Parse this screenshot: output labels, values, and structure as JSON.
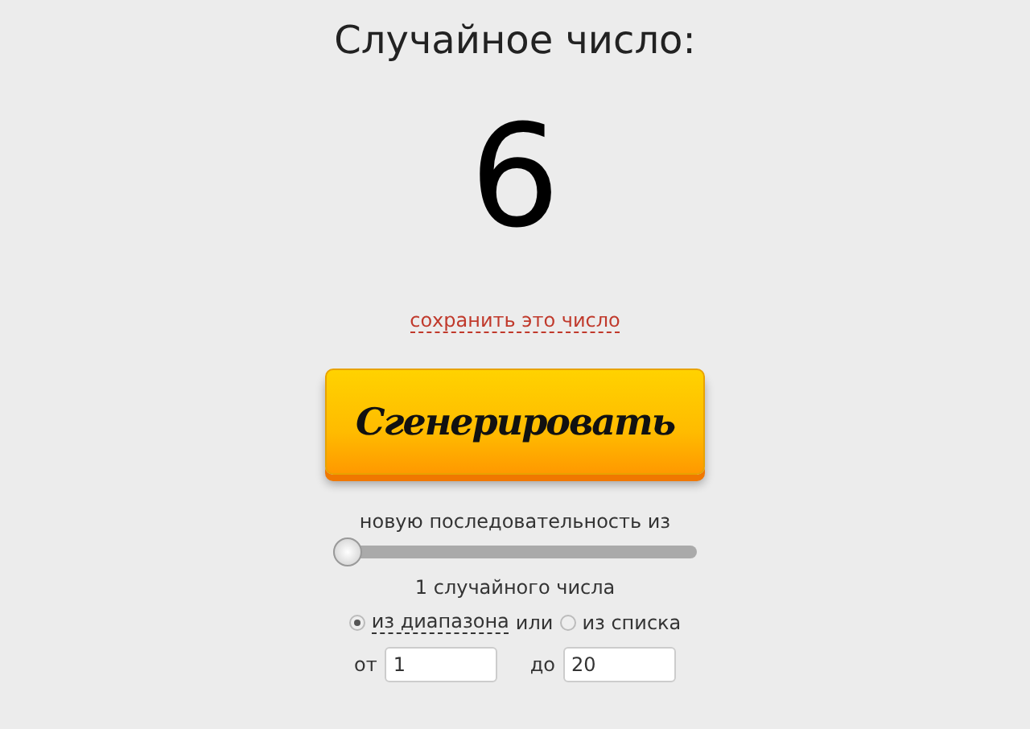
{
  "title": "Случайное число:",
  "number": "6",
  "save_link": "сохранить это число",
  "generate_button": "Сгенерировать",
  "sequence_label": "новую последовательность из",
  "count_slider": {
    "level": 0
  },
  "count_text": "1 случайного числа",
  "source_options": [
    {
      "label": "из диапазона",
      "selected": true
    },
    {
      "label": "из списка",
      "selected": false
    }
  ],
  "source_joiner": "или",
  "range": {
    "from_label": "от",
    "from_value": "1",
    "to_label": "до",
    "to_value": "20"
  }
}
